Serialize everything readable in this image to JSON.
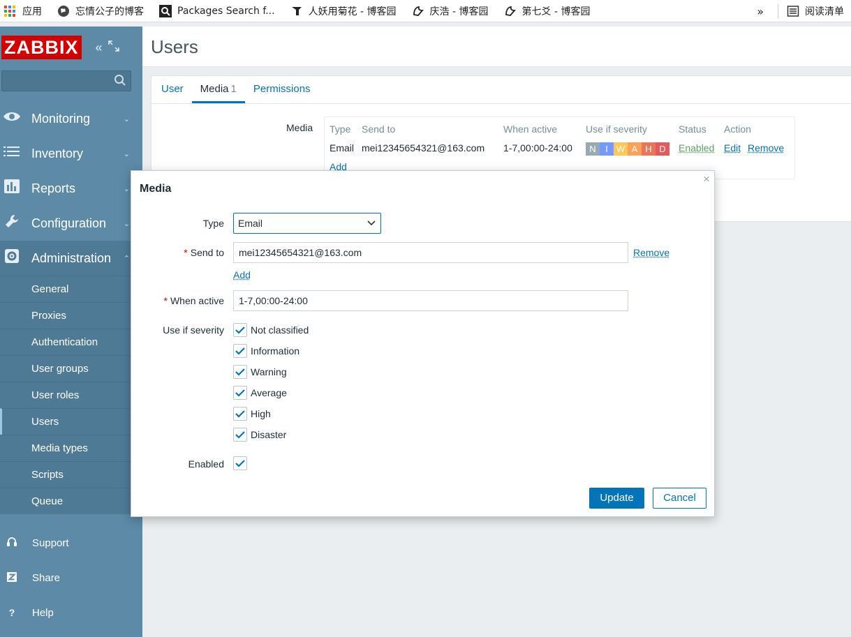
{
  "bookmarks": {
    "apps_label": "应用",
    "items": [
      {
        "label": "忘情公子的博客",
        "icon": "globe-icon"
      },
      {
        "label": "Packages Search f...",
        "icon": "search-icon"
      },
      {
        "label": "人妖用菊花 - 博客园",
        "icon": "blog-icon"
      },
      {
        "label": "庆浩 - 博客园",
        "icon": "blog-icon"
      },
      {
        "label": "第七爻 - 博客园",
        "icon": "blog-icon"
      }
    ],
    "more": "»",
    "reading_list": "阅读清单"
  },
  "sidebar": {
    "logo": "ZABBIX",
    "search_placeholder": "",
    "menu": [
      {
        "label": "Monitoring",
        "icon": "eye-icon"
      },
      {
        "label": "Inventory",
        "icon": "list-icon"
      },
      {
        "label": "Reports",
        "icon": "bar-chart-icon"
      },
      {
        "label": "Configuration",
        "icon": "wrench-icon"
      },
      {
        "label": "Administration",
        "icon": "gear-icon"
      }
    ],
    "submenu": [
      "General",
      "Proxies",
      "Authentication",
      "User groups",
      "User roles",
      "Users",
      "Media types",
      "Scripts",
      "Queue"
    ],
    "bottom": [
      {
        "label": "Support",
        "icon": "headset-icon"
      },
      {
        "label": "Share",
        "icon": "share-z-icon"
      },
      {
        "label": "Help",
        "icon": "help-icon"
      }
    ]
  },
  "page": {
    "title": "Users",
    "tabs": [
      {
        "label": "User"
      },
      {
        "label": "Media",
        "count": "1"
      },
      {
        "label": "Permissions"
      }
    ],
    "media_label": "Media",
    "table": {
      "headers": [
        "Type",
        "Send to",
        "When active",
        "Use if severity",
        "Status",
        "Action"
      ],
      "row": {
        "type": "Email",
        "send_to": "mei12345654321@163.com",
        "when_active": "1-7,00:00-24:00",
        "severity": [
          {
            "letter": "N",
            "color": "#97aab3"
          },
          {
            "letter": "I",
            "color": "#7499ff"
          },
          {
            "letter": "W",
            "color": "#ffc859"
          },
          {
            "letter": "A",
            "color": "#ffa059"
          },
          {
            "letter": "H",
            "color": "#e97659"
          },
          {
            "letter": "D",
            "color": "#e45959"
          }
        ],
        "status": "Enabled",
        "edit": "Edit",
        "remove": "Remove"
      },
      "add": "Add"
    }
  },
  "dialog": {
    "title": "Media",
    "close": "×",
    "type_label": "Type",
    "type_value": "Email",
    "send_to_label": "Send to",
    "send_to_value": "mei12345654321@163.com",
    "remove": "Remove",
    "add": "Add",
    "when_active_label": "When active",
    "when_active_value": "1-7,00:00-24:00",
    "severity_label": "Use if severity",
    "severities": [
      "Not classified",
      "Information",
      "Warning",
      "Average",
      "High",
      "Disaster"
    ],
    "enabled_label": "Enabled",
    "update": "Update",
    "cancel": "Cancel"
  }
}
